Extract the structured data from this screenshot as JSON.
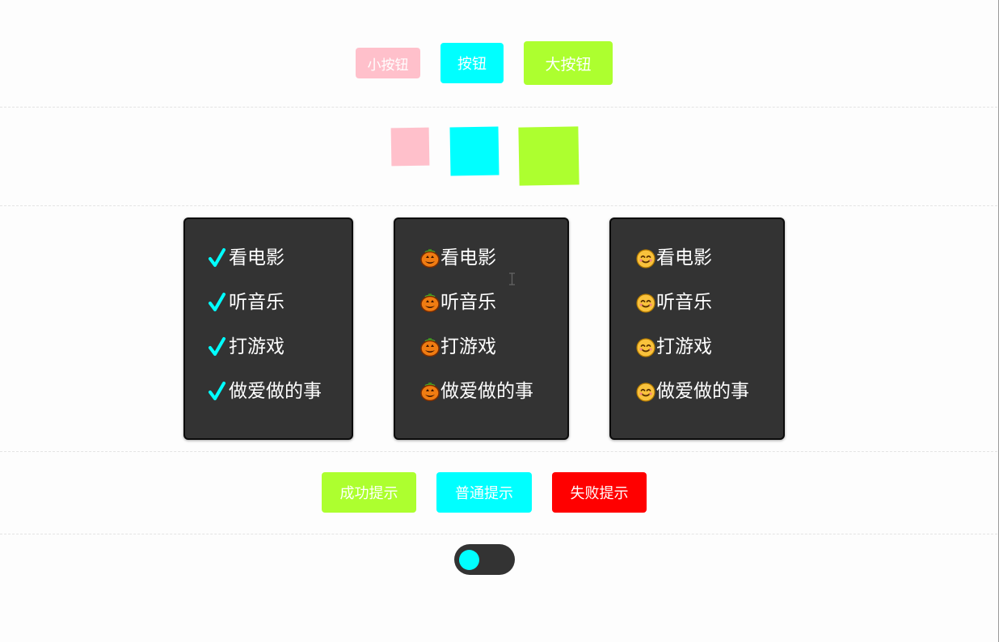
{
  "buttons": {
    "small": {
      "label": "小按钮",
      "color": "#ffc0cb"
    },
    "medium": {
      "label": "按钮",
      "color": "#00ffff"
    },
    "large": {
      "label": "大按钮",
      "color": "#adff2f"
    }
  },
  "squares": {
    "pink": "#ffc0cb",
    "cyan": "#00ffff",
    "green": "#adff2f"
  },
  "cards": [
    {
      "marker": "check-icon",
      "marker_color": "#00ffff",
      "items": [
        "看电影",
        "听音乐",
        "打游戏",
        "做爱做的事"
      ]
    },
    {
      "marker": "pumpkin-icon",
      "items": [
        "看电影",
        "听音乐",
        "打游戏",
        "做爱做的事"
      ]
    },
    {
      "marker": "smiley-icon",
      "items": [
        "看电影",
        "听音乐",
        "打游戏",
        "做爱做的事"
      ]
    }
  ],
  "alerts": {
    "success": {
      "label": "成功提示",
      "color": "#adff2f"
    },
    "info": {
      "label": "普通提示",
      "color": "#00ffff"
    },
    "error": {
      "label": "失败提示",
      "color": "#ff0000"
    }
  },
  "toggle": {
    "state": "off",
    "knob_color": "#00ffff",
    "track_color": "#333333"
  }
}
